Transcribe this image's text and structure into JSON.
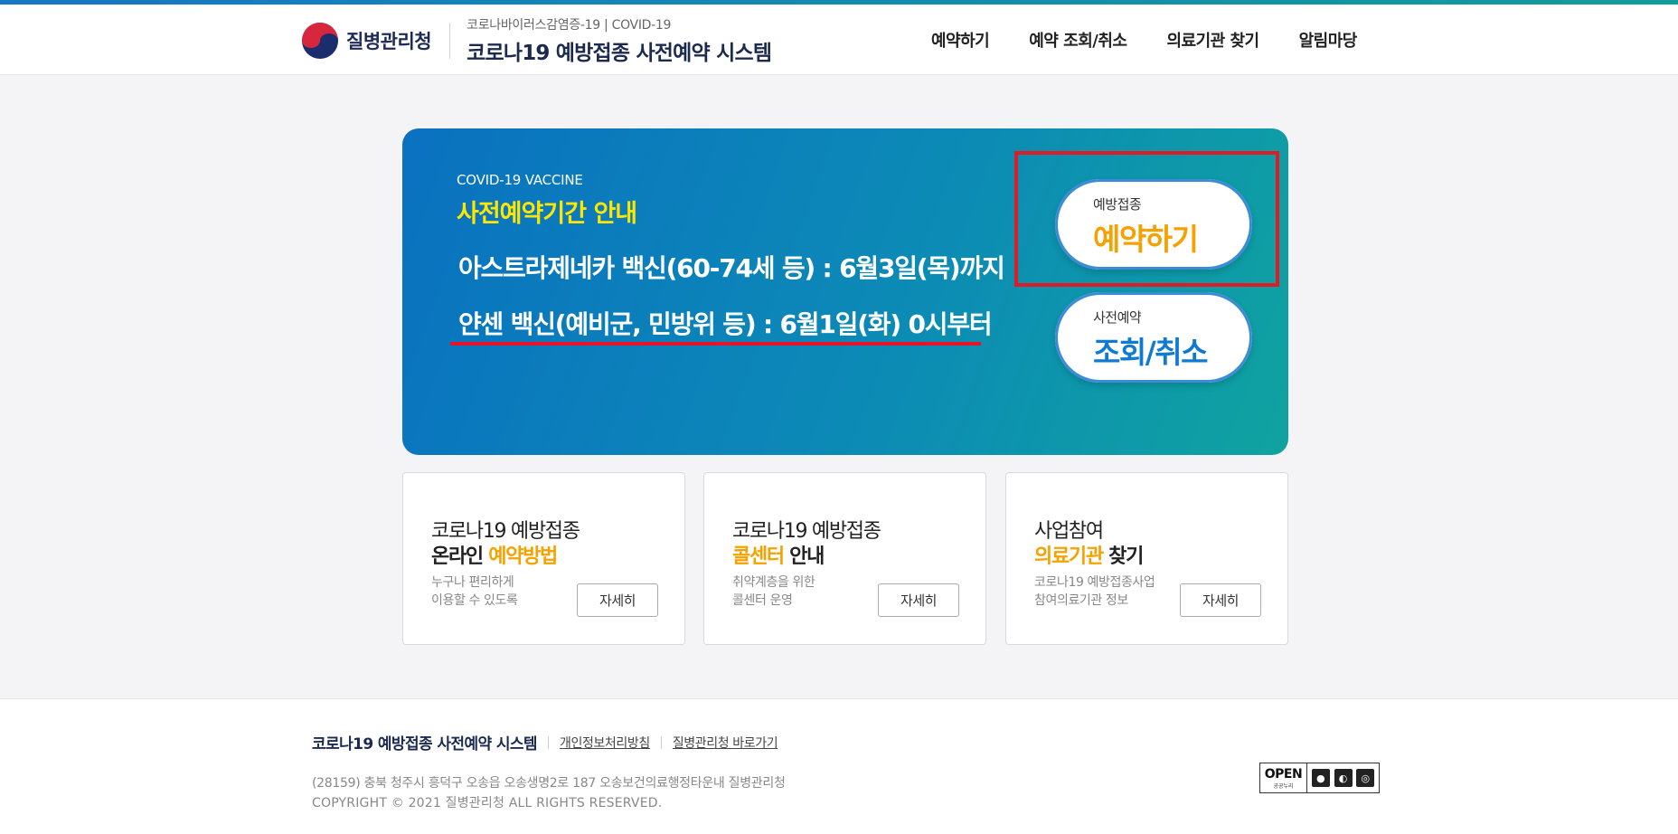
{
  "header": {
    "org_name": "질병관리청",
    "system_sub": "코로나바이러스감염증-19 | COVID-19",
    "system_title": "코로나19 예방접종 사전예약 시스템"
  },
  "nav": [
    {
      "label": "예약하기"
    },
    {
      "label": "예약 조회/취소"
    },
    {
      "label": "의료기관 찾기"
    },
    {
      "label": "알림마당"
    }
  ],
  "hero": {
    "eyebrow": "COVID-19 VACCINE",
    "title": "사전예약기간 안내",
    "line1": "아스트라제네카 백신(60-74세 등) : 6월3일(목)까지",
    "line2": "얀센 백신(예비군, 민방위 등) : 6월1일(화) 0시부터",
    "reserve_button": {
      "small": "예방접종",
      "big": "예약하기"
    },
    "lookup_button": {
      "small": "사전예약",
      "big": "조회/취소"
    }
  },
  "cards": [
    {
      "line1": "코로나19 예방접종",
      "line2_plain": "온라인 ",
      "line2_hl": "예약방법",
      "line2_hl_first": false,
      "desc1": "누구나 편리하게",
      "desc2": "이용할 수 있도록",
      "button": "자세히"
    },
    {
      "line1": "코로나19 예방접종",
      "line2_hl": "콜센터",
      "line2_plain": " 안내",
      "line2_hl_first": true,
      "desc1": "취약계층을 위한",
      "desc2": "콜센터 운영",
      "button": "자세히"
    },
    {
      "line1": "사업참여",
      "line2_hl": "의료기관",
      "line2_plain": " 찾기",
      "line2_hl_first": true,
      "desc1": "코로나19 예방접종사업",
      "desc2": "참여의료기관 정보",
      "button": "자세히"
    }
  ],
  "footer": {
    "title": "코로나19 예방접종 사전예약 시스템",
    "privacy": "개인정보처리방침",
    "kdca_link": "질병관리청 바로가기",
    "address": "(28159) 충북 청주시 흥덕구 오송읍 오송생명2로 187 오송보건의료행정타운내 질병관리청",
    "copyright": "COPYRIGHT © 2021 질병관리청 ALL RIGHTS RESERVED.",
    "kogl": {
      "open": "OPEN",
      "sub": "공공누리"
    }
  },
  "colors": {
    "accent_yellow": "#ffe600",
    "accent_orange": "#f5a100",
    "accent_blue": "#0f7ad1",
    "highlight_red": "#e01b24"
  }
}
